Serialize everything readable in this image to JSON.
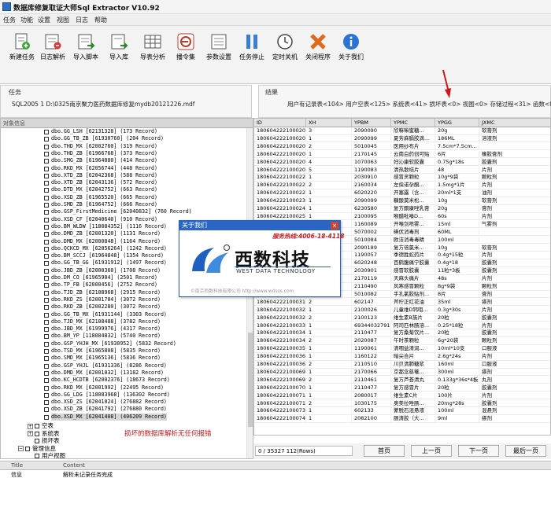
{
  "window": {
    "title": "数据库修复取证大师Sql Extractor V10.92"
  },
  "menu": [
    "任务",
    "功能",
    "设置",
    "视图",
    "日志",
    "帮助"
  ],
  "toolbar": [
    {
      "label": "新建任务",
      "icon": "new-task-icon"
    },
    {
      "label": "日志解析",
      "icon": "log-parse-icon"
    },
    {
      "label": "导入脚本",
      "icon": "import-script-icon"
    },
    {
      "label": "导入库",
      "icon": "import-db-icon"
    },
    {
      "label": "导表分析",
      "icon": "table-analysis-icon"
    },
    {
      "label": "播令集",
      "icon": "command-set-icon"
    },
    {
      "label": "参数设置",
      "icon": "settings-icon"
    },
    {
      "label": "任务停止",
      "icon": "stop-task-icon"
    },
    {
      "label": "定时关机",
      "icon": "timer-shutdown-icon"
    },
    {
      "label": "关闭程序",
      "icon": "close-program-icon"
    },
    {
      "label": "关于我们",
      "icon": "about-icon"
    }
  ],
  "task": {
    "caption": "任务",
    "path": "SQL2005 1 D:\\0325南京聚力医药数据库修复mydb20121226.mdf"
  },
  "result": {
    "caption": "结果",
    "summary": "用户有记录表<104> 用户空表<125> 系统表<41> 损坏表<0> 视图<0> 存储过程<31> 函数<0> 触"
  },
  "tree": {
    "header": "对象信息",
    "tables": [
      "dbo.GG_LSH [62131328] (173 Record)",
      "dbo.GG_TB_ZB [61930760] (204 Record)",
      "dbo.THD_MX [62002760] (319 Record)",
      "dbo.THD_ZB [61966768] (373 Record)",
      "dbo.SMG_ZB [61964080] (414 Record)",
      "dbo.RKD_MX [62056744] (448 Record)",
      "dbo.XTD_ZB [62042368] (588 Record)",
      "dbo.XTD_ZB [62043136] (572 Record)",
      "dbo.DTD_MX [62042752] (663 Record)",
      "dbo.XSD_ZB [61965520] (665 Record)",
      "dbo.SMD_ZB [61964752] (666 Record)",
      "dbo.GSP_FirstMedicine [62040832] (760 Record)",
      "dbo.XSD_CF [62040640] (910 Record)",
      "dbo.BM_WLDW [118084352] (1116 Record)",
      "dbo.DMD_ZB [62001320] (1131 Record)",
      "dbo.DMD_MX [62000848] (1164 Record)",
      "dbo.QCKCD_MX [62056264] (1242 Record)",
      "dbo.BM_SCCJ [61964848] (1354 Record)",
      "dbo.GG_TB_GG [61931912] (1497 Record)",
      "dbo.JBD_ZB [62000360] (1708 Record)",
      "dbo.DM_CO [61965904] (2501 Record)",
      "dbo.TP_FB [62000456] (2752 Record)",
      "dbo.TJD_ZB [62108968] (2915 Record)",
      "dbo.RKD_ZS [62001704] (3072 Record)",
      "dbo.RKD_ZB [62002280] (3072 Record)",
      "dbo.GG_TB_MX [61931144] (3303 Record)",
      "dbo.TJD_MX [62108488] (3782 Record)",
      "dbo.JBD_MX [61999976] (4317 Record)",
      "dbo.BM_YP [118084832] (5740 Record)",
      "dbo.GSP_YHJH_MX [61930952] (5832 Record)",
      "dbo.TSD_MX [61965808] (5835 Record)",
      "dbo.SMD_MX [61965136] (5836 Record)",
      "dbo.GSP_YHJL [61931336] (8286 Record)",
      "dbo.DMD_MX [62001032] (13182 Record)",
      "dbo.KC_HCDTB [62002376] (18673 Record)",
      "dbo.RKD_MX [62001992] (22495 Record)",
      "dbo.GG_LDG [118083968] (136302 Record)",
      "dbo.XSD_ZS [62041024] (276882 Record)",
      "dbo.XSD_ZB [62041792] (276880 Record)",
      "dbo.XSD_MX [62041408] (406209 Record)"
    ],
    "groups": [
      {
        "label": "空表",
        "pm": "+"
      },
      {
        "label": "系统表",
        "pm": "+"
      },
      {
        "label": "损坏表",
        "pm": ""
      },
      {
        "label": "管理信息",
        "pm": "−"
      },
      {
        "label": "用户视图",
        "pm": ""
      },
      {
        "label": "存储过程",
        "pm": "+"
      }
    ],
    "note": "损坏的数据库解析无任何报错"
  },
  "grid": {
    "columns": [
      "ID",
      "XH",
      "YPBM",
      "YPMC",
      "YPGG",
      "JXMC"
    ],
    "rows": [
      [
        "180604222100020",
        "3",
        "2090090",
        "欣嘛嘛蜜糖...",
        "20g",
        "软膏剂"
      ],
      [
        "180604222100020",
        "1",
        "2090099",
        "夏芳麻膈胶滴...",
        "186ML",
        "溶液剂"
      ],
      [
        "180604222100020",
        "2",
        "5010045",
        "医用纱布片",
        "7.5cm*7.5cm...",
        ""
      ],
      [
        "180604222100020",
        "1",
        "2170145",
        "云南白药创可贴",
        "6片",
        "橡胶膏剂"
      ],
      [
        "180604222100020",
        "4",
        "1070063",
        "妇沁康软胶囊",
        "0.75g*18s",
        "胶囊剂"
      ],
      [
        "180604222100020",
        "5",
        "1190083",
        "清热散结片",
        "48",
        "片剂"
      ],
      [
        "180604222100022",
        "1",
        "2030910",
        "感冒灵颗粒",
        "10g*9袋",
        "颗粒剂"
      ],
      [
        "180604222100022",
        "2",
        "2160034",
        "左炔诺孕酮...",
        "1.5mg*1片",
        "片剂"
      ],
      [
        "180604222100022",
        "1",
        "6020220",
        "开塞露（含...",
        "20ml*1支",
        "油剂"
      ],
      [
        "180604222100023",
        "1",
        "2090099",
        "糠酸莫米松...",
        "10g",
        "软膏剂"
      ],
      [
        "180604222100024",
        "1",
        "6230580",
        "复方酮康唑乳膏",
        "20g",
        "膏剂"
      ],
      [
        "180604222100025",
        "1",
        "2100095",
        "喉醋吡嗪D...",
        "60s",
        "片剂"
      ],
      [
        "180604222100026",
        "1",
        "1160089",
        "开喉剑喷雾...",
        "15ml",
        "气雾剂"
      ],
      [
        "180604222100027",
        "1",
        "5070002",
        "碘伏消毒剂",
        "60ML",
        ""
      ],
      [
        "180604222100028",
        "1",
        "5010084",
        "欧洁消毒毒精",
        "100ml",
        ""
      ],
      [
        "180604222100029",
        "1",
        "2090189",
        "复方倍氯米...",
        "10g",
        "软膏剂"
      ],
      [
        "180604222100029",
        "2",
        "1190057",
        "季德胜蛇药片",
        "0.4g*15粒",
        "片剂"
      ],
      [
        "180604222100029",
        "3",
        "6020248",
        "百鹤腹痛宁胶囊",
        "0.4g*18",
        "胶囊剂"
      ],
      [
        "180604222100030",
        "1",
        "2030901",
        "感冒软胶囊",
        "11粒*3板",
        "胶囊剂"
      ],
      [
        "180604222100030",
        "1",
        "2170119",
        "天麻头痛片",
        "48s",
        "片剂"
      ],
      [
        "180604222100030",
        "1",
        "2110490",
        "风寒感冒颗粒",
        "8g*9袋",
        "颗粒剂"
      ],
      [
        "180604222100031",
        "1",
        "5010082",
        "手孔氯胶贴剂...",
        "8片",
        "膏剂"
      ],
      [
        "180604222100031",
        "2",
        "602147",
        "斧柠正红花油",
        "35ml",
        "搽剂"
      ],
      [
        "180604222100032",
        "1",
        "2100026",
        "儿童维D钙咀...",
        "0.3g*30s",
        "片剂"
      ],
      [
        "180604222100032",
        "2",
        "2100123",
        "维生素B族片",
        "20粒",
        "胶囊剂"
      ],
      [
        "180604222100033",
        "1",
        "693440327917B",
        "阿司匹林肠溶...",
        "0.25*18粒",
        "片剂"
      ],
      [
        "180604222100034",
        "1",
        "2110477",
        "复方桑菊饮片...",
        "20粒",
        "胶囊剂"
      ],
      [
        "180604222100034",
        "2",
        "2020087",
        "午时茶颗粒",
        "6g*20袋",
        "颗粒剂"
      ],
      [
        "180604222100035",
        "1",
        "1190061",
        "清咽益清润...",
        "10ml*10支",
        "口服液"
      ],
      [
        "180604222100036",
        "1",
        "1160122",
        "暗尖合片",
        "2.6g*24s",
        "片剂"
      ],
      [
        "180604222100036",
        "2",
        "2110510",
        "川贝清肺糖浆",
        "160ml",
        "口服液"
      ],
      [
        "180604222100069",
        "1",
        "2170066",
        "京都念慈菴...",
        "300ml",
        "搽剂"
      ],
      [
        "180604222100069",
        "2",
        "2110461",
        "复方芦荟清丸",
        "0.133g*36s*4板",
        "丸剂"
      ],
      [
        "180604222100070",
        "1",
        "2110477",
        "复方感冒片",
        "20粒",
        "胶囊剂"
      ],
      [
        "180604222100071",
        "1",
        "2080017",
        "维生素C片",
        "100片",
        "片剂"
      ],
      [
        "180604222100071",
        "2",
        "1030175",
        "奥美拉唑肠...",
        "20mg*28s",
        "胶囊剂"
      ],
      [
        "180604222100073",
        "1",
        "602133",
        "蒙脱石混悬液",
        "100ml",
        "混悬剂"
      ],
      [
        "180604222100074",
        "1",
        "2082100",
        "肠清胶（大...",
        "9ml",
        "搽剂"
      ]
    ],
    "rowcount": "0 / 35327  112(Rows)",
    "buttons": [
      "首页",
      "上一页",
      "下一页",
      "最后一页"
    ]
  },
  "log": {
    "columns": [
      "Title",
      "Content"
    ],
    "rows": [
      [
        "信息",
        "解析未记录任务完成"
      ]
    ]
  },
  "about": {
    "title": "关于我们",
    "close": "×",
    "hotline": "服务热线:4006-18-4118",
    "brand_cn": "西数科技",
    "brand_en": "WEST DATA TECHNOLOGY",
    "copyright": "©南京西数科技有限公司 http://www.wdsos.com"
  },
  "colors": {
    "accent": "#2b66c6",
    "note": "#d0161b",
    "dialog_title": "#2b66c6"
  }
}
